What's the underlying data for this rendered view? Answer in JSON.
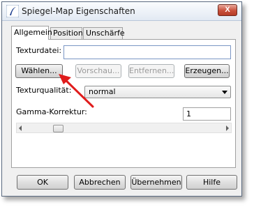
{
  "window": {
    "title": "Spiegel-Map Eigenschaften",
    "close_label": "X"
  },
  "tabs": [
    {
      "label": "Allgemein",
      "active": true
    },
    {
      "label": "Position",
      "active": false
    },
    {
      "label": "Unschärfe",
      "active": false
    }
  ],
  "texture": {
    "file_label": "Texturdatei:",
    "file_value": "",
    "buttons": {
      "choose": "Wählen...",
      "preview": "Vorschau...",
      "remove": "Entfernen...",
      "create": "Erzeugen..."
    },
    "quality_label": "Texturqualität:",
    "quality_value": "normal"
  },
  "gamma": {
    "label": "Gamma-Korrektur:",
    "value": "1",
    "slider_position": 0.14
  },
  "footer": {
    "ok": "OK",
    "cancel": "Abbrechen",
    "apply": "Übernehmen",
    "help": "Hilfe"
  },
  "colors": {
    "annotation_arrow": "#e01c1c"
  }
}
